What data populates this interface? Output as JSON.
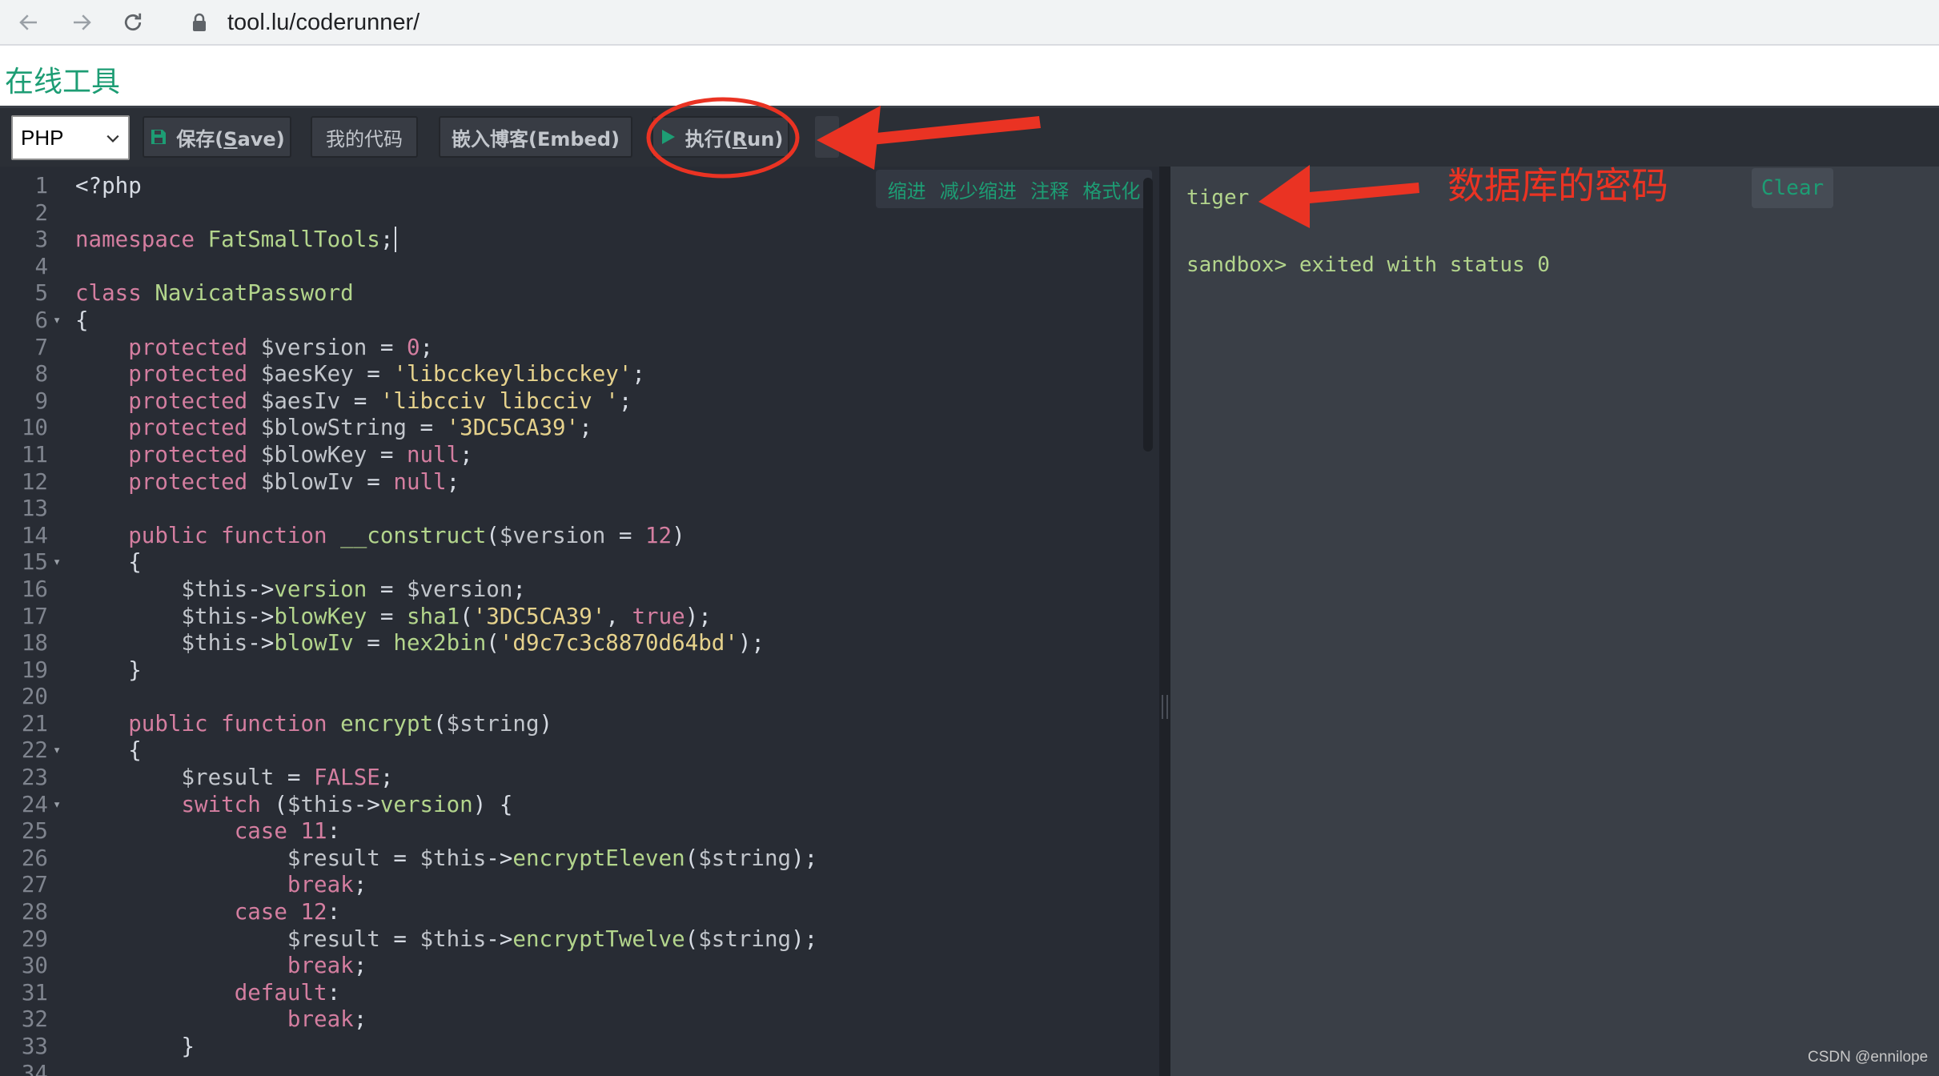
{
  "browser": {
    "url": "tool.lu/coderunner/",
    "back_icon": "arrow-left-icon",
    "forward_icon": "arrow-right-icon",
    "reload_icon": "reload-icon",
    "lock_icon": "lock-icon"
  },
  "site": {
    "title": "在线工具"
  },
  "toolbar": {
    "language": "PHP",
    "save_label_prefix": "保存(",
    "save_label_key": "S",
    "save_label_suffix": "ave)",
    "mycode_label": "我的代码",
    "embed_label": "嵌入博客(Embed)",
    "run_label_prefix": "执行(",
    "run_label_key": "R",
    "run_label_suffix": "un)"
  },
  "editor": {
    "actions": [
      "缩进",
      "减少缩进",
      "注释",
      "格式化"
    ],
    "folds": [
      6,
      15,
      22,
      24
    ],
    "lines": [
      "<?php",
      "",
      "namespace FatSmallTools;",
      "",
      "class NavicatPassword",
      "{",
      "    protected $version = 0;",
      "    protected $aesKey = 'libcckeylibcckey';",
      "    protected $aesIv = 'libcciv libcciv ';",
      "    protected $blowString = '3DC5CA39';",
      "    protected $blowKey = null;",
      "    protected $blowIv = null;",
      "",
      "    public function __construct($version = 12)",
      "    {",
      "        $this->version = $version;",
      "        $this->blowKey = sha1('3DC5CA39', true);",
      "        $this->blowIv = hex2bin('d9c7c3c8870d64bd');",
      "    }",
      "",
      "    public function encrypt($string)",
      "    {",
      "        $result = FALSE;",
      "        switch ($this->version) {",
      "            case 11:",
      "                $result = $this->encryptEleven($string);",
      "                break;",
      "            case 12:",
      "                $result = $this->encryptTwelve($string);",
      "                break;",
      "            default:",
      "                break;",
      "        }",
      ""
    ]
  },
  "output": {
    "lines": [
      "tiger",
      "",
      "sandbox> exited with status 0"
    ],
    "clear_label": "Clear"
  },
  "annotation": {
    "text": "数据库的密码",
    "color": "#ea3323"
  },
  "watermark": "CSDN @ennilope"
}
